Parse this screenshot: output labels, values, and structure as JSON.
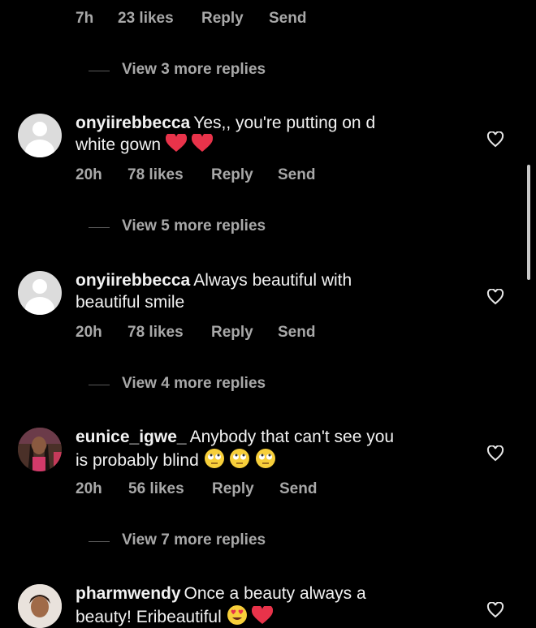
{
  "top_comment": {
    "time": "7h",
    "likes": "23 likes",
    "reply": "Reply",
    "send": "Send"
  },
  "replies_0": "View 3 more replies",
  "comments": [
    {
      "username": "onyiirebbecca",
      "text": "Yes,, you're putting on d",
      "text2": "white gown",
      "time": "20h",
      "likes": "78 likes",
      "reply": "Reply",
      "send": "Send",
      "more": "View 5 more replies"
    },
    {
      "username": "onyiirebbecca",
      "text": "Always beautiful with",
      "text2": "beautiful smile",
      "time": "20h",
      "likes": "78 likes",
      "reply": "Reply",
      "send": "Send",
      "more": "View 4 more replies"
    },
    {
      "username": "eunice_igwe_",
      "text": "Anybody that can't see you",
      "text2": "is probably blind",
      "time": "20h",
      "likes": "56 likes",
      "reply": "Reply",
      "send": "Send",
      "more": "View 7 more replies"
    },
    {
      "username": "pharmwendy",
      "text": "Once a beauty always a",
      "text2": "beauty! Eribeautiful"
    }
  ],
  "icons": {
    "like": "heart-outline-icon",
    "emoji_heart": "red-heart-emoji",
    "emoji_eyeroll": "rolling-eyes-emoji",
    "emoji_hearteyes": "heart-eyes-emoji"
  },
  "colors": {
    "background": "#000000",
    "text": "#f2f2f2",
    "muted": "#a8a8a8",
    "heart": "#e8334a"
  }
}
